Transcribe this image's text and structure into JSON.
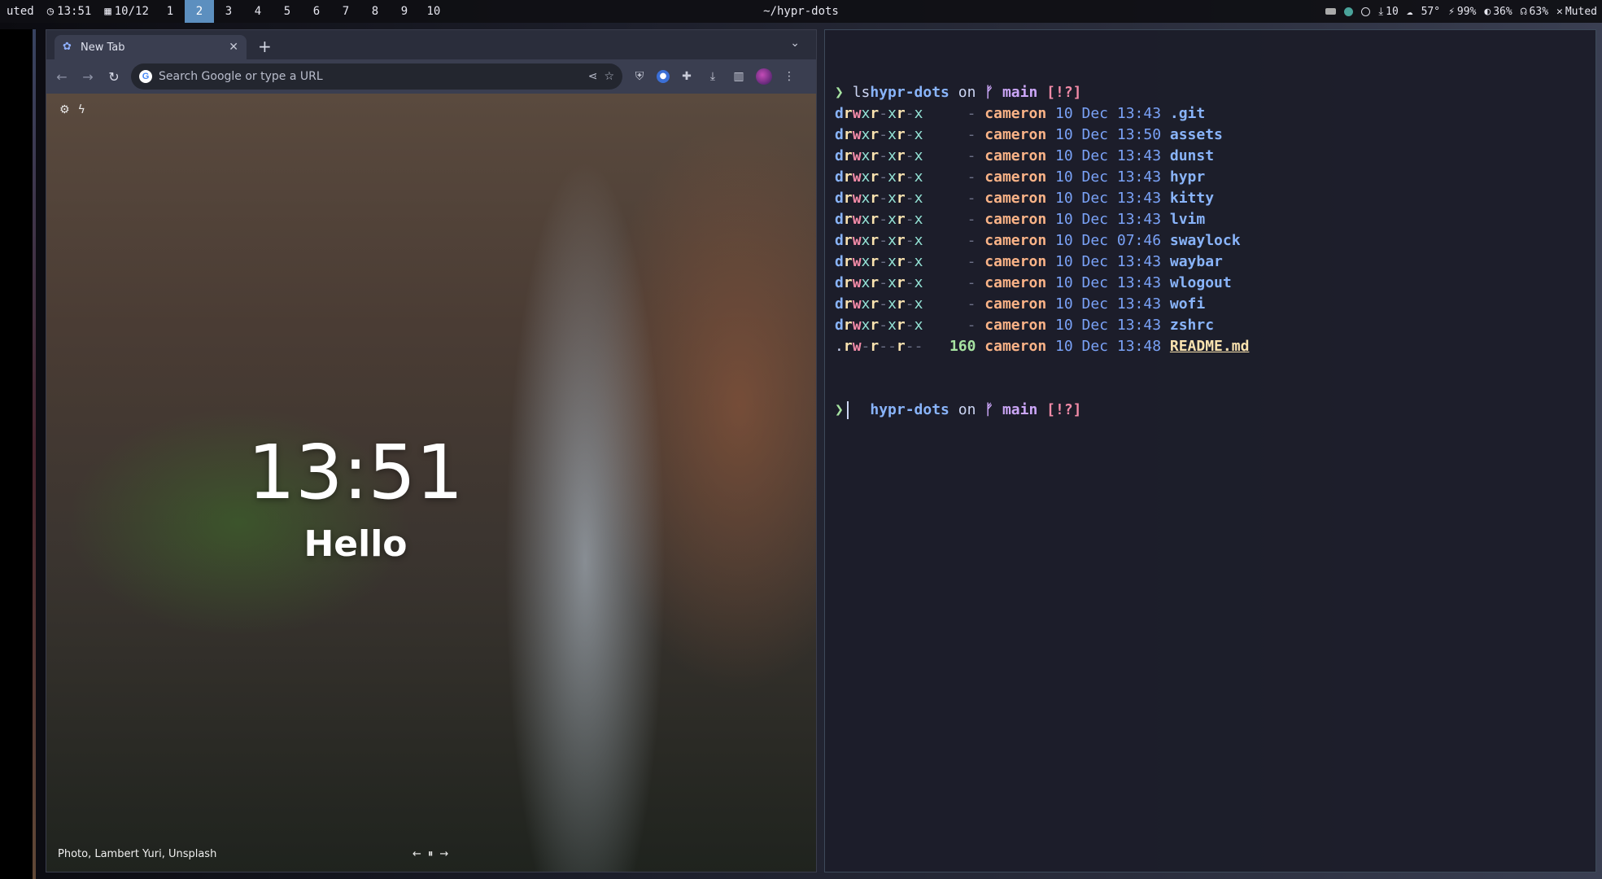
{
  "topbar": {
    "muted_left": "uted",
    "time": "13:51",
    "date": "10/12",
    "workspaces": [
      "1",
      "2",
      "3",
      "4",
      "5",
      "6",
      "7",
      "8",
      "9",
      "10"
    ],
    "active_workspace": "2",
    "window_title": "~/hypr-dots",
    "updates": "10",
    "temperature": "57°",
    "battery": "99%",
    "brightness": "36%",
    "headphones": "63%",
    "muted_right": "Muted"
  },
  "browser": {
    "tab_title": "New Tab",
    "omnibox_placeholder": "Search Google or type a URL",
    "clock": "13:51",
    "greeting": "Hello",
    "photo_credit": "Photo, Lambert Yuri, Unsplash"
  },
  "terminal": {
    "prompt": {
      "dir": "hypr-dots",
      "on": "on",
      "branch_icon": "ᚠ",
      "branch": "main",
      "status": "[!?]"
    },
    "command": "ls",
    "entries": [
      {
        "perms": "drwxr-xr-x",
        "size": "-",
        "user": "cameron",
        "day": "10",
        "month": "Dec",
        "time": "13:43",
        "name": ".git"
      },
      {
        "perms": "drwxr-xr-x",
        "size": "-",
        "user": "cameron",
        "day": "10",
        "month": "Dec",
        "time": "13:50",
        "name": "assets"
      },
      {
        "perms": "drwxr-xr-x",
        "size": "-",
        "user": "cameron",
        "day": "10",
        "month": "Dec",
        "time": "13:43",
        "name": "dunst"
      },
      {
        "perms": "drwxr-xr-x",
        "size": "-",
        "user": "cameron",
        "day": "10",
        "month": "Dec",
        "time": "13:43",
        "name": "hypr"
      },
      {
        "perms": "drwxr-xr-x",
        "size": "-",
        "user": "cameron",
        "day": "10",
        "month": "Dec",
        "time": "13:43",
        "name": "kitty"
      },
      {
        "perms": "drwxr-xr-x",
        "size": "-",
        "user": "cameron",
        "day": "10",
        "month": "Dec",
        "time": "13:43",
        "name": "lvim"
      },
      {
        "perms": "drwxr-xr-x",
        "size": "-",
        "user": "cameron",
        "day": "10",
        "month": "Dec",
        "time": "07:46",
        "name": "swaylock"
      },
      {
        "perms": "drwxr-xr-x",
        "size": "-",
        "user": "cameron",
        "day": "10",
        "month": "Dec",
        "time": "13:43",
        "name": "waybar"
      },
      {
        "perms": "drwxr-xr-x",
        "size": "-",
        "user": "cameron",
        "day": "10",
        "month": "Dec",
        "time": "13:43",
        "name": "wlogout"
      },
      {
        "perms": "drwxr-xr-x",
        "size": "-",
        "user": "cameron",
        "day": "10",
        "month": "Dec",
        "time": "13:43",
        "name": "wofi"
      },
      {
        "perms": "drwxr-xr-x",
        "size": "-",
        "user": "cameron",
        "day": "10",
        "month": "Dec",
        "time": "13:43",
        "name": "zshrc"
      },
      {
        "perms": ".rw-r--r--",
        "size": "160",
        "user": "cameron",
        "day": "10",
        "month": "Dec",
        "time": "13:48",
        "name": "README.md"
      }
    ],
    "prompt_symbol": "❯"
  }
}
